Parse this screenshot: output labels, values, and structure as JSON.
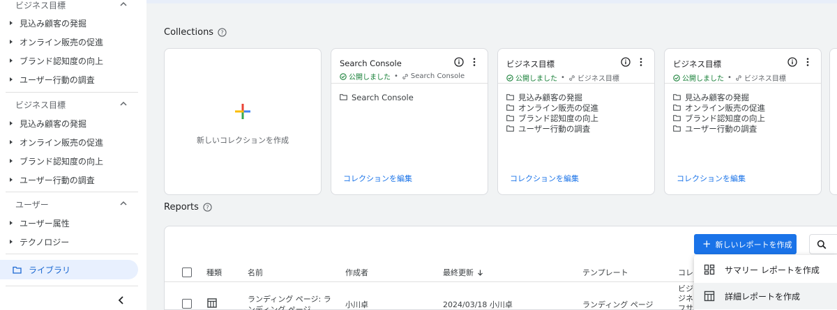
{
  "sidebar": {
    "groups": [
      {
        "title": "ビジネス目標",
        "items": [
          "見込み顧客の発掘",
          "オンライン販売の促進",
          "ブランド認知度の向上",
          "ユーザー行動の調査"
        ]
      },
      {
        "title": "ビジネス目標",
        "items": [
          "見込み顧客の発掘",
          "オンライン販売の促進",
          "ブランド認知度の向上",
          "ユーザー行動の調査"
        ]
      },
      {
        "title": "ユーザー",
        "items": [
          "ユーザー属性",
          "テクノロジー"
        ]
      }
    ],
    "library_label": "ライブラリ"
  },
  "collections": {
    "title": "Collections",
    "new_label": "新しいコレクションを作成",
    "cards": [
      {
        "title": "Search Console",
        "status": "公開しました",
        "source": "Search Console",
        "items": [
          "Search Console"
        ],
        "edit": "コレクションを編集"
      },
      {
        "title": "ビジネス目標",
        "status": "公開しました",
        "source": "ビジネス目標",
        "items": [
          "見込み顧客の発掘",
          "オンライン販売の促進",
          "ブランド認知度の向上",
          "ユーザー行動の調査"
        ],
        "edit": "コレクションを編集"
      },
      {
        "title": "ビジネス目標",
        "status": "公開しました",
        "source": "ビジネス目標",
        "items": [
          "見込み顧客の発掘",
          "オンライン販売の促進",
          "ブランド認知度の向上",
          "ユーザー行動の調査"
        ],
        "edit": "コレクションを編集"
      }
    ]
  },
  "reports": {
    "title": "Reports",
    "new_button": "新しいレポートを作成",
    "columns": [
      "種類",
      "名前",
      "作成者",
      "最終更新",
      "テンプレート",
      "コレ"
    ],
    "rows": [
      {
        "name_line1": "ランディング ページ: ラ",
        "name_line2": "ンディング ページ",
        "creator": "小川卓",
        "updated": "2024/03/18 小川卓",
        "template": "ランディング ページ",
        "collection_lines": [
          "ビジ",
          "ジネ",
          "フサ"
        ]
      }
    ]
  },
  "menu": {
    "items": [
      "サマリー レポートを作成",
      "詳細レポートを作成"
    ]
  },
  "colors": {
    "accent": "#1a73e8",
    "published": "#188038",
    "selected_bg": "#e8f0fe"
  }
}
